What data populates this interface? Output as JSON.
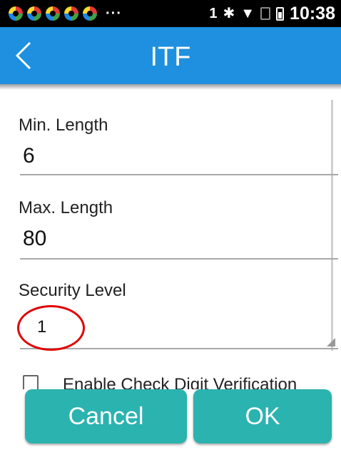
{
  "status_bar": {
    "notification_icons": [
      "app-notification-icon",
      "app-notification-icon",
      "app-notification-icon",
      "app-notification-icon",
      "app-notification-icon"
    ],
    "overflow": "···",
    "sim_slot": "1",
    "bluetooth": "✱",
    "wifi": "▼",
    "time": "10:38"
  },
  "app_bar": {
    "back_icon": "chevron-left-icon",
    "title": "ITF",
    "color": "#1e90df"
  },
  "form": {
    "min_length": {
      "label": "Min. Length",
      "value": "6"
    },
    "max_length": {
      "label": "Max. Length",
      "value": "80"
    },
    "security_level": {
      "label": "Security Level",
      "value": "1"
    },
    "check_digit": {
      "label": "Enable Check Digit Verification",
      "checked": false
    }
  },
  "buttons": {
    "cancel": "Cancel",
    "ok": "OK",
    "color": "#2bb3b0"
  }
}
